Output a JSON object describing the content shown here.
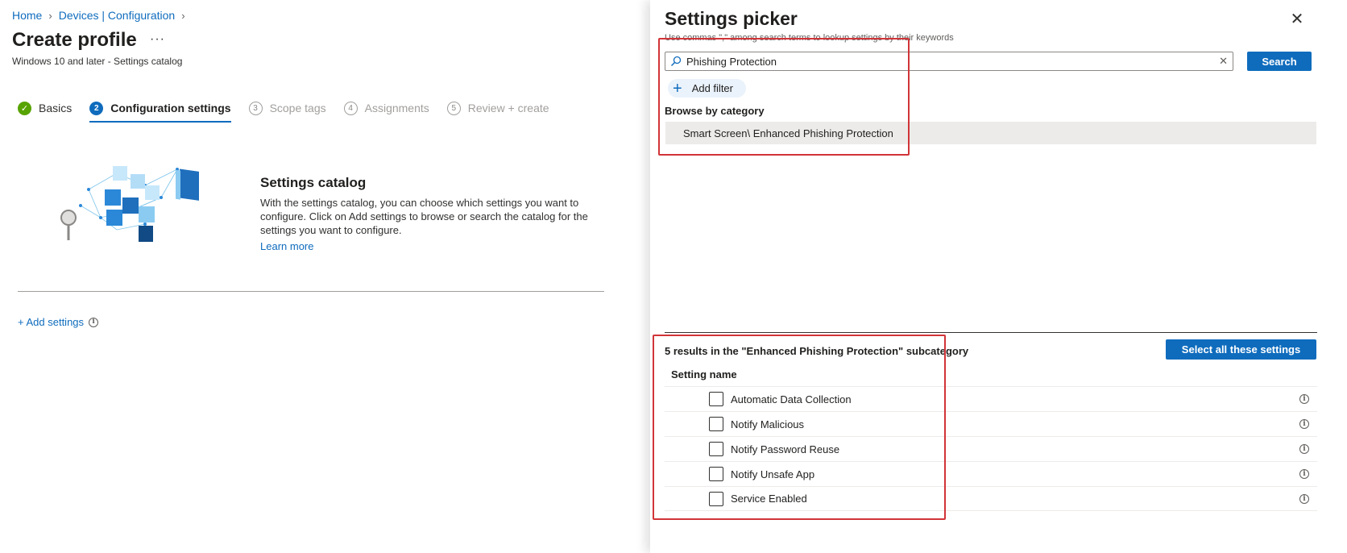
{
  "breadcrumb": {
    "home": "Home",
    "devices": "Devices | Configuration"
  },
  "profile": {
    "title": "Create profile",
    "more": "···",
    "subtitle": "Windows 10 and later - Settings catalog"
  },
  "steps": [
    {
      "num": "✓",
      "label": "Basics",
      "state": "done"
    },
    {
      "num": "2",
      "label": "Configuration settings",
      "state": "active"
    },
    {
      "num": "3",
      "label": "Scope tags",
      "state": "todo"
    },
    {
      "num": "4",
      "label": "Assignments",
      "state": "todo"
    },
    {
      "num": "5",
      "label": "Review + create",
      "state": "todo"
    }
  ],
  "catalog": {
    "title": "Settings catalog",
    "description": "With the settings catalog, you can choose which settings you want to configure. Click on Add settings to browse or search the catalog for the settings you want to configure.",
    "learn_more": "Learn more",
    "add_settings": "+ Add settings"
  },
  "picker": {
    "title": "Settings picker",
    "hint": "Use commas \",\" among search terms to lookup settings by their keywords",
    "search_value": "Phishing Protection",
    "search_button": "Search",
    "add_filter": "Add filter",
    "browse_label": "Browse by category",
    "category": "Smart Screen\\ Enhanced Phishing Protection",
    "results_text": "5 results in the \"Enhanced Phishing Protection\" subcategory",
    "select_all": "Select all these settings",
    "column_header": "Setting name",
    "settings": [
      "Automatic Data Collection",
      "Notify Malicious",
      "Notify Password Reuse",
      "Notify Unsafe App",
      "Service Enabled"
    ]
  },
  "icons": {
    "close": "close-icon",
    "search": "search-icon",
    "info": "info-icon",
    "plus": "plus-icon",
    "chevron": "chevron-right-icon"
  },
  "colors": {
    "accent": "#0f6cbd",
    "success": "#57a300",
    "highlight": "#d13438"
  }
}
